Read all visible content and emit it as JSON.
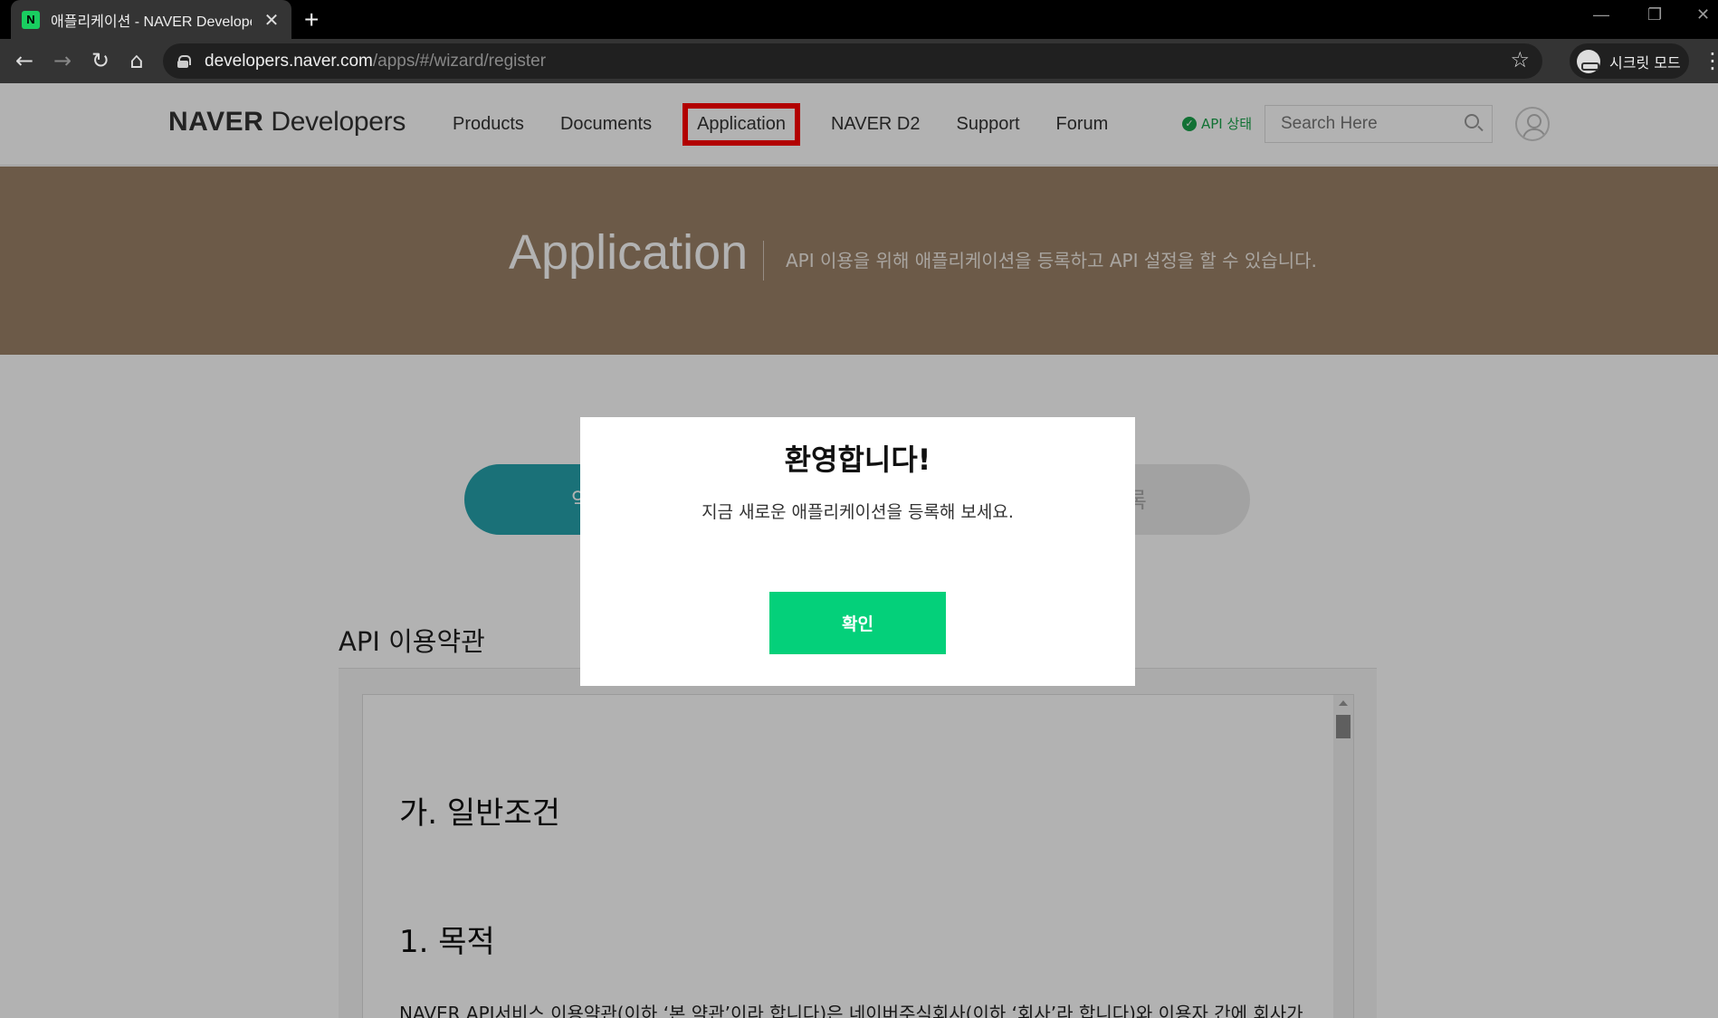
{
  "browser": {
    "tab_title": "애플리케이션 - NAVER Developers",
    "favicon_letter": "N",
    "url_host": "developers.naver.com",
    "url_path": "/apps/#/wizard/register",
    "incognito_label": "시크릿 모드"
  },
  "header": {
    "logo_bold": "NAVER",
    "logo_light": " Developers",
    "nav": [
      "Products",
      "Documents",
      "Application",
      "NAVER D2",
      "Support",
      "Forum"
    ],
    "active_nav": "Application",
    "api_status": "API 상태",
    "search_placeholder": "Search Here"
  },
  "banner": {
    "title": "Application",
    "description": "API 이용을 위해 애플리케이션을 등록하고 API 설정을 할 수 있습니다."
  },
  "steps": {
    "left_partial": "약",
    "right_partial": "션 등록"
  },
  "terms": {
    "title": "API 이용약관",
    "section_heading": "가. 일반조건",
    "subsection": "1. 목적",
    "text": "NAVER API서비스 이용약관(이하 ‘본 약관’이라 합니다)은 네이버주식회사(이하 ‘회사’라 합니다)와 이용자 간에 회사가"
  },
  "modal": {
    "title": "환영합니다!",
    "description": "지금 새로운 애플리케이션을 등록해 보세요.",
    "confirm_label": "확인"
  },
  "colors": {
    "brand_green": "#04d07a",
    "banner_brown": "#9b8167",
    "step_active": "#26a2ac",
    "highlight_red": "#ff0000"
  }
}
